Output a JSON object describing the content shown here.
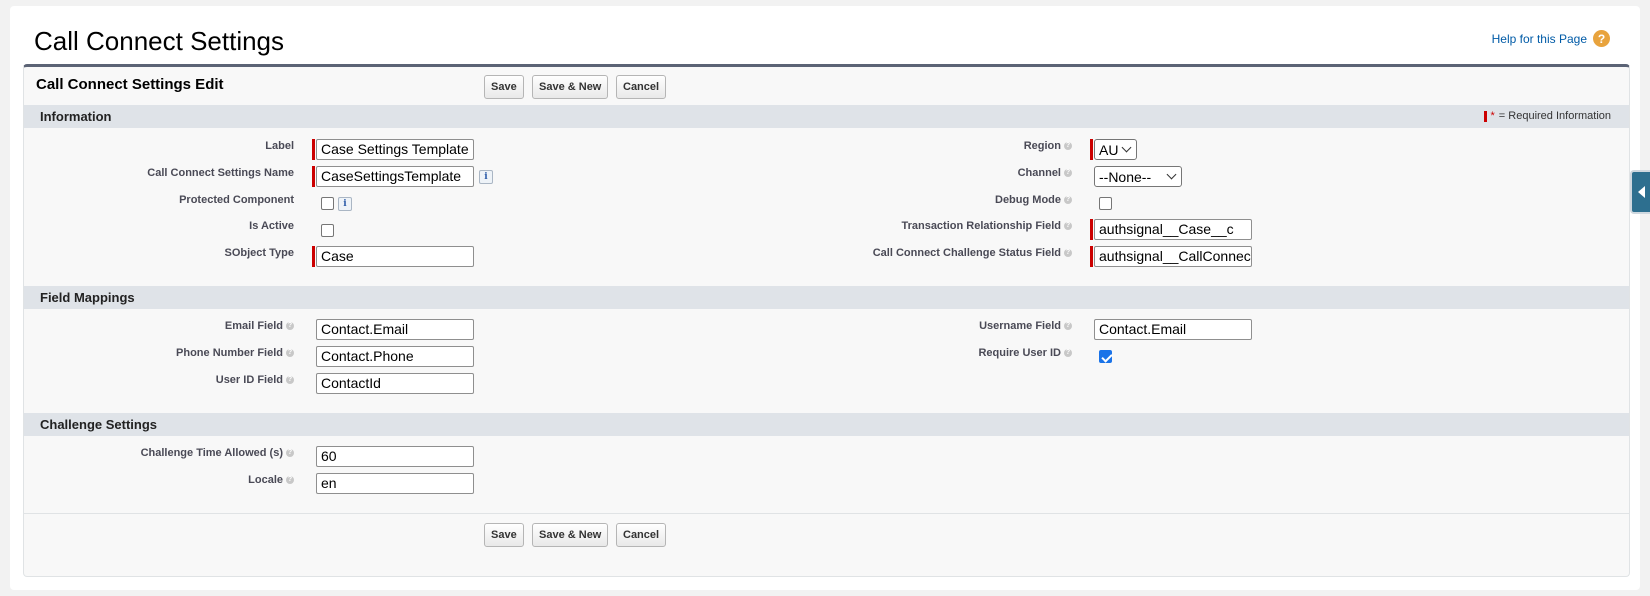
{
  "page": {
    "title": "Call Connect Settings",
    "help_link": "Help for this Page",
    "help_icon": "?"
  },
  "block": {
    "title": "Call Connect Settings Edit",
    "save_label": "Save",
    "save_new_label": "Save & New",
    "cancel_label": "Cancel"
  },
  "sections": {
    "information": {
      "title": "Information",
      "required_legend": "= Required Information",
      "label": {
        "label": "Label",
        "value": "Case Settings Template"
      },
      "name": {
        "label": "Call Connect Settings Name",
        "value": "CaseSettingsTemplate"
      },
      "protected": {
        "label": "Protected Component",
        "checked": false
      },
      "is_active": {
        "label": "Is Active",
        "checked": false
      },
      "sobject": {
        "label": "SObject Type",
        "value": "Case"
      },
      "region": {
        "label": "Region",
        "value": "AU"
      },
      "channel": {
        "label": "Channel",
        "value": "--None--"
      },
      "debug": {
        "label": "Debug Mode",
        "checked": false
      },
      "txn_field": {
        "label": "Transaction Relationship Field",
        "value": "authsignal__Case__c"
      },
      "challenge_status": {
        "label": "Call Connect Challenge Status Field",
        "value": "authsignal__CallConnectChallengeStatus__c"
      }
    },
    "field_mappings": {
      "title": "Field Mappings",
      "email": {
        "label": "Email Field",
        "value": "Contact.Email"
      },
      "phone": {
        "label": "Phone Number Field",
        "value": "Contact.Phone"
      },
      "user_id": {
        "label": "User ID Field",
        "value": "ContactId"
      },
      "username": {
        "label": "Username Field",
        "value": "Contact.Email"
      },
      "require_user_id": {
        "label": "Require User ID",
        "checked": true
      }
    },
    "challenge": {
      "title": "Challenge Settings",
      "time_allowed": {
        "label": "Challenge Time Allowed (s)",
        "value": "60"
      },
      "locale": {
        "label": "Locale",
        "value": "en"
      }
    }
  },
  "icons": {
    "info": "i",
    "help_dot": "?"
  },
  "colors": {
    "required": "#cc0000",
    "header_bar": "#5b6375",
    "section_bg": "#dfe3e8",
    "link": "#015ba7",
    "checkbox_on": "#1a73e8"
  }
}
